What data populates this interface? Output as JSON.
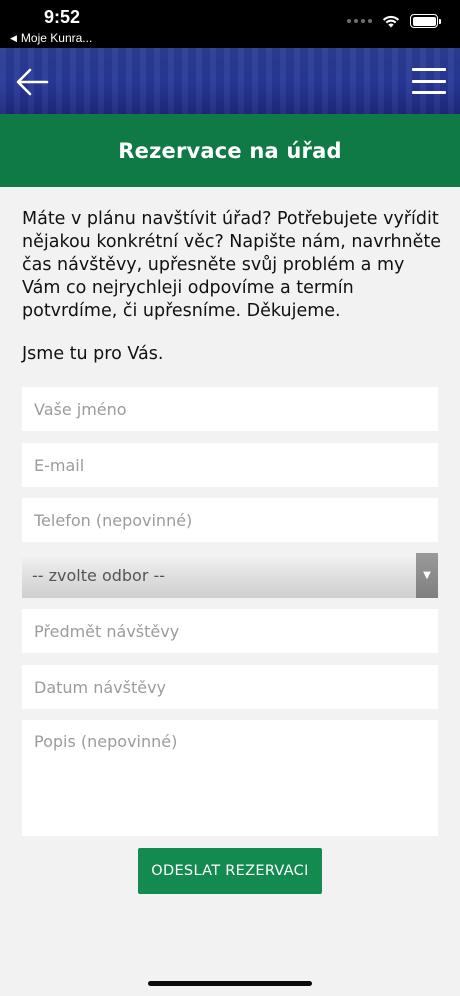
{
  "status_bar": {
    "time": "9:52",
    "back_app": "Moje Kunra...",
    "back_icon": "triangle-left-icon",
    "wifi_icon": "wifi-icon",
    "battery_icon": "battery-icon"
  },
  "header": {
    "back_icon": "arrow-left-icon",
    "menu_icon": "hamburger-menu-icon",
    "background_color": "#23339a"
  },
  "title_bar": {
    "title": "Rezervace na úřad",
    "color": "#0f7a45"
  },
  "intro": {
    "text": "Máte v plánu navštívit úřad? Potřebujete vyřídit nějakou konkrétní věc? Napište nám, navrhněte čas návštěvy, upřesněte svůj problém a my Vám co nejrychleji odpovíme a termín potvrdíme, či upřesníme. Děkujeme.",
    "greeting": "Jsme tu pro Vás."
  },
  "form": {
    "name_placeholder": "Vaše jméno",
    "email_placeholder": "E-mail",
    "phone_placeholder": "Telefon (nepovinné)",
    "department_select": "-- zvolte odbor --",
    "subject_placeholder": "Předmět návštěvy",
    "date_placeholder": "Datum návštěvy",
    "description_placeholder": "Popis (nepovinné)",
    "submit_label": "ODESLAT REZERVACI",
    "submit_color": "#138a4f"
  }
}
